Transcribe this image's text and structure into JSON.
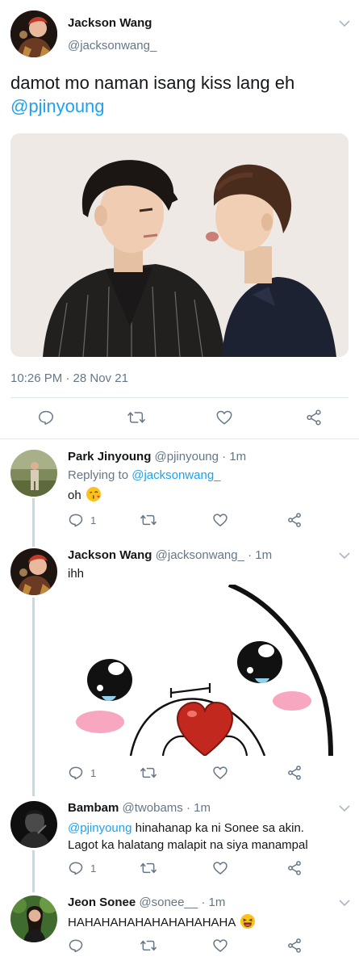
{
  "main_tweet": {
    "display_name": "Jackson Wang",
    "handle": "@jacksonwang_",
    "text": "damot mo naman isang kiss lang eh",
    "mention": "@pjinyoung",
    "timestamp": "10:26 PM · 28 Nov 21"
  },
  "replies": [
    {
      "display_name": "Park Jinyoung",
      "handle": "@pjinyoung",
      "time": "· 1m",
      "replying_label": "Replying to",
      "replying_to": "@jacksonwang_",
      "text": "oh",
      "reply_count": "1"
    },
    {
      "display_name": "Jackson Wang",
      "handle": "@jacksonwang_",
      "time": "· 1m",
      "text": "ihh",
      "reply_count": "1"
    },
    {
      "display_name": "Bambam",
      "handle": "@twobams",
      "time": "· 1m",
      "mention": "@pjinyoung",
      "text_line1": "hinahanap ka ni Sonee sa akin.",
      "text_line2": "Lagot ka halatang malapit na siya manampal",
      "reply_count": "1"
    },
    {
      "display_name": "Jeon Sonee",
      "handle": "@sonee__",
      "time": "· 1m",
      "text": "HAHAHAHAHAHAHAHAHAHA"
    }
  ],
  "icons": {
    "reply": "reply-icon",
    "retweet": "retweet-icon",
    "like": "like-icon",
    "share": "share-icon",
    "caret": "chevron-down-icon"
  },
  "colors": {
    "link": "#1da1f2",
    "muted": "#657786",
    "icon": "#657786",
    "divider": "#e1e8ed",
    "thread_line": "#ccd6dd"
  }
}
